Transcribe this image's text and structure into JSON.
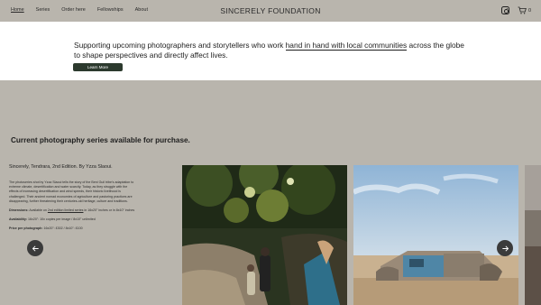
{
  "nav": {
    "items": [
      {
        "label": "Home",
        "active": true
      },
      {
        "label": "Series",
        "active": false
      },
      {
        "label": "Order here",
        "active": false
      },
      {
        "label": "Fellowships",
        "active": false
      },
      {
        "label": "About",
        "active": false
      }
    ]
  },
  "brand": "SINCERELY FOUNDATION",
  "cart": {
    "count": "0"
  },
  "hero": {
    "text_before": "Supporting upcoming photographers and storytellers who work ",
    "text_highlight": "hand in hand with local communities",
    "text_after": " across the globe to shape perspectives and directly affect lives.",
    "button_label": "Learn More"
  },
  "series": {
    "title": "Current photography series available for purchase.",
    "card": {
      "title": "Sincerely, Tendrara, 2nd Edition. By Yzza Slaoui.",
      "description": "The photoseries shot by Yzza Slaoui tells the story of the Beni Guil tribe's adaptation to extreme climate, desertification and water scarcity. Today, as they struggle with the effects of increasing desertification and wind speeds, their historic livelihood is challenged. Their ancient nomad economies of agriculture and pastoring practices are disappearing, further threatening their centuries-old heritage, culture and traditions.",
      "dimensions_label": "Dimensions:",
      "dimensions_pre": " Available on ",
      "dimensions_link": "2nd edition limited series",
      "dimensions_post": " in 16x20\" inches or in 8x10\" inches",
      "availability_label": "Availability:",
      "availability_value": " 16x20\": 10x copies per image / 8x10\" unlimited",
      "price_label": "Price per photograph:",
      "price_value": " 16x20\": £302 / 8x10\": £100"
    }
  },
  "colors": {
    "page_bg": "#b9b5ad",
    "hero_bg": "#ffffff",
    "button_bg": "#2c3a2e",
    "arrow_bg": "#3b3b3b"
  }
}
